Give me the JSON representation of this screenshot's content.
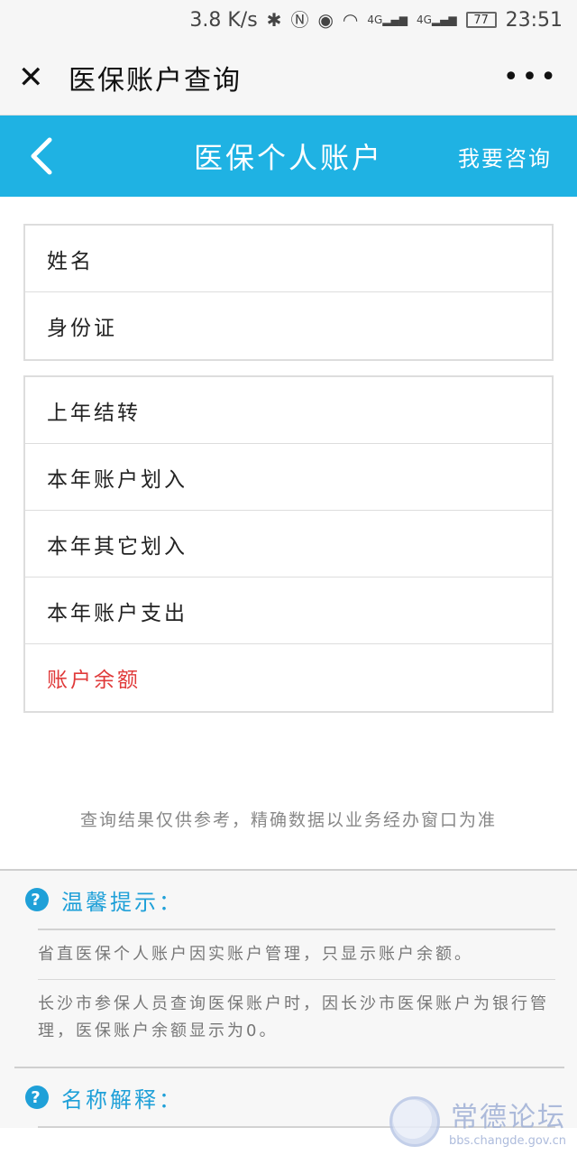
{
  "status_bar": {
    "network_speed": "3.8 K/s",
    "network_type_1": "4G",
    "network_type_2": "4G",
    "battery": "77",
    "time": "23:51"
  },
  "wx_bar": {
    "title": "医保账户查询",
    "more": "•••"
  },
  "header": {
    "title": "医保个人账户",
    "consult": "我要咨询"
  },
  "identity_card": {
    "rows": [
      {
        "label": "姓名",
        "value": ""
      },
      {
        "label": "身份证",
        "value": ""
      }
    ]
  },
  "account_card": {
    "rows": [
      {
        "label": "上年结转",
        "value": ""
      },
      {
        "label": "本年账户划入",
        "value": ""
      },
      {
        "label": "本年其它划入",
        "value": ""
      },
      {
        "label": "本年账户支出",
        "value": ""
      },
      {
        "label": "账户余额",
        "value": ""
      }
    ]
  },
  "disclaimer": "查询结果仅供参考，精确数据以业务经办窗口为准",
  "tips": {
    "title": "温馨提示：",
    "items": [
      "省直医保个人账户因实账户管理，只显示账户余额。",
      "长沙市参保人员查询医保账户时，因长沙市医保账户为银行管理，医保账户余额显示为0。"
    ]
  },
  "glossary": {
    "title": "名称解释："
  },
  "watermark": {
    "name": "常德论坛",
    "url": "bbs.changde.gov.cn"
  },
  "colors": {
    "header_blue": "#1fb2e3",
    "highlight_red": "#e03a3a",
    "tip_blue": "#1fa0d8"
  }
}
